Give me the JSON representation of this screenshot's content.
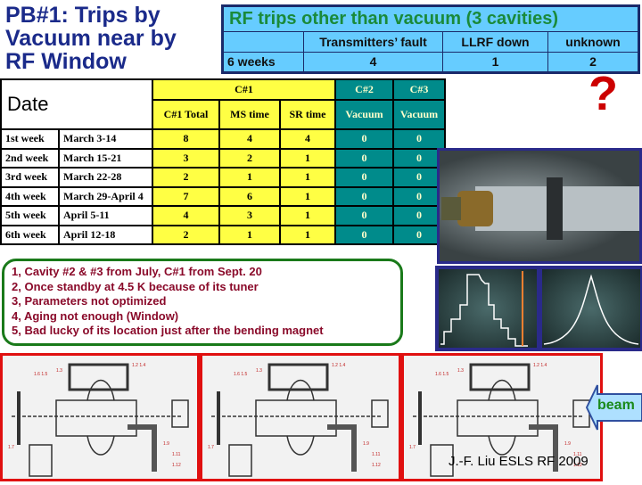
{
  "title": [
    "PB#1:  Trips by",
    "Vacuum near by",
    "RF Window"
  ],
  "rf_table": {
    "title": "RF trips other than vacuum (3 cavities)",
    "headers": [
      "",
      "Transmitters’ fault",
      "LLRF down",
      "unknown"
    ],
    "row": [
      "6 weeks",
      "4",
      "1",
      "2"
    ]
  },
  "question_mark": "?",
  "main_table": {
    "date_header": "Date",
    "c1": "C#1",
    "c2": "C#2",
    "c3": "C#3",
    "subheaders": [
      "C#1 Total",
      "MS time",
      "SR time",
      "Vacuum",
      "Vacuum"
    ],
    "rows": [
      [
        "1st week",
        "March 3-14",
        "8",
        "4",
        "4",
        "0",
        "0"
      ],
      [
        "2nd week",
        "March 15-21",
        "3",
        "2",
        "1",
        "0",
        "0"
      ],
      [
        "3rd week",
        "March 22-28",
        "2",
        "1",
        "1",
        "0",
        "0"
      ],
      [
        "4th week",
        "March 29-April 4",
        "7",
        "6",
        "1",
        "0",
        "0"
      ],
      [
        "5th week",
        "April 5-11",
        "4",
        "3",
        "1",
        "0",
        "0"
      ],
      [
        "6th week",
        "April 12-18",
        "2",
        "1",
        "1",
        "0",
        "0"
      ]
    ]
  },
  "notes": [
    "1,  Cavity #2 & #3 from July, C#1 from Sept. 20",
    "2,  Once standby at 4.5 K because of its tuner",
    "3,  Parameters not optimized",
    "4,  Aging not enough (Window)",
    "5,  Bad lucky of its location just after the bending magnet"
  ],
  "beam_label": "beam",
  "author": "J.-F. Liu ESLS RF 2009",
  "colors": {
    "title": "#1a2a8a",
    "rf_bg": "#66ccff",
    "rf_title": "#1a8a3a",
    "c1_bg": "#ffff44",
    "c23_bg": "#008b8b",
    "notes": "#8a0a2a",
    "panel_border": "#e01010"
  }
}
